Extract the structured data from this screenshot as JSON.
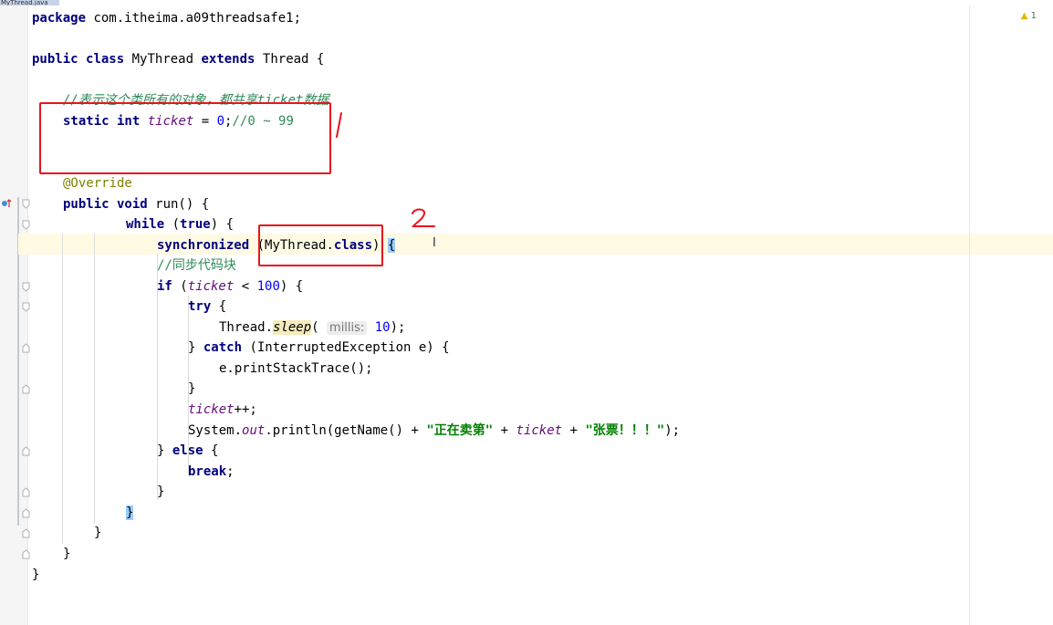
{
  "tab": {
    "label": "MyThread.java"
  },
  "inspection": {
    "warning_count": "1"
  },
  "code": {
    "l1_package": "package",
    "l1_name": " com.itheima.a09threadsafe1;",
    "l3_public": "public",
    "l3_class": "class",
    "l3_name": " MyThread ",
    "l3_extends": "extends",
    "l3_rest": " Thread {",
    "l5_comment": "//表示这个类所有的对象，都共享ticket数据",
    "l6_static_int": "static int",
    "l6_field": "ticket",
    "l6_eq": " = ",
    "l6_num": "0",
    "l6_semi": ";",
    "l6_comment": "//0 ~ 99",
    "l9_ann": "@Override",
    "l10_public_void": "public void",
    "l10_rest": " run() {",
    "l11_while": "while",
    "l11_open": " (",
    "l11_true": "true",
    "l11_close": ") {",
    "l12_sync": "synchronized",
    "l12_open": " (MyThread.",
    "l12_class": "class",
    "l12_close": ")",
    "l12_brace": "{",
    "l13_comment": "//同步代码块",
    "l14_if": "if",
    "l14_open": " (",
    "l14_field": "ticket",
    "l14_lt": " < ",
    "l14_num": "100",
    "l14_close": ") {",
    "l15_try": "try",
    "l15_rest": " {",
    "l16_thread": "Thread.",
    "l16_sleep": "sleep",
    "l16_open": "( ",
    "l16_hint": "millis:",
    "l16_num": " 10",
    "l16_close": ");",
    "l17_close": "} ",
    "l17_catch": "catch",
    "l17_rest": " (InterruptedException e) {",
    "l18_text": "e.printStackTrace();",
    "l19_text": "}",
    "l20_field": "ticket",
    "l20_rest": "++;",
    "l21_sys": "System.",
    "l21_out": "out",
    "l21_print": ".println(getName() + ",
    "l21_str1": "\"正在卖第\"",
    "l21_plus1": " + ",
    "l21_field": "ticket",
    "l21_plus2": " + ",
    "l21_str2": "\"张票！！！\"",
    "l21_end": ");",
    "l22_close": "} ",
    "l22_else": "else",
    "l22_rest": " {",
    "l23_break": "break",
    "l23_semi": ";",
    "l24_text": "}",
    "l25_brace": "}",
    "l26_text": "}",
    "l27_text": "}",
    "l28_text": "}"
  },
  "annotations": {
    "mark_1": "1",
    "mark_2": "2"
  },
  "colors": {
    "keyword": "#000080",
    "field": "#660e7a",
    "number": "#0000ff",
    "string": "#008000",
    "annotation": "#808000",
    "red_marker": "#e8141b"
  }
}
